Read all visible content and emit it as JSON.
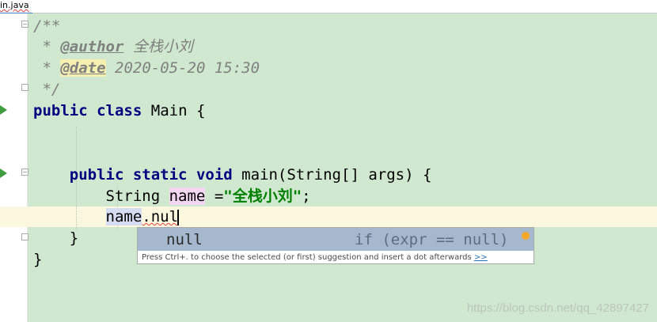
{
  "tab": {
    "title": "in.java"
  },
  "code": {
    "comment_open": "/**",
    "star": " *",
    "author_tag": "@author",
    "author_name": "全栈小刘",
    "date_tag": "@date",
    "date_value": "2020-05-20 15:30",
    "comment_close": " */",
    "kw_public": "public",
    "kw_class": "class",
    "class_name": "Main",
    "open_brace": "{",
    "kw_static": "static",
    "kw_void": "void",
    "method_sig": "main(String[] args)",
    "type_string": "String",
    "var_name": "name",
    "assign": "=",
    "string_literal": "\"全栈小刘\"",
    "semicolon": ";",
    "typed_text": "name",
    "typed_suffix": ".nul",
    "close_brace": "}"
  },
  "completion": {
    "item_name": "null",
    "item_tail": "if (expr == null)",
    "hint_text": "Press Ctrl+. to choose the selected (or first) suggestion and insert a dot afterwards",
    "hint_link": ">>"
  },
  "watermark": "https://blog.csdn.net/qq_42897427",
  "colors": {
    "editor_bg": "#cfe8cf",
    "current_line_bg": "#fbf8df",
    "keyword": "#000080",
    "string": "#008000",
    "comment": "#808080",
    "selected_item_bg": "#a6b8ce"
  }
}
